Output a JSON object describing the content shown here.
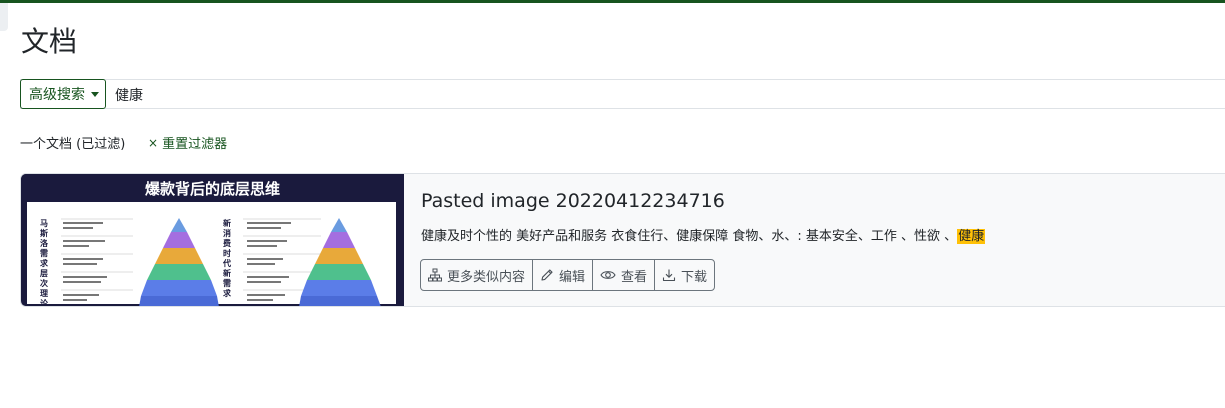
{
  "page": {
    "title": "文档"
  },
  "search": {
    "advanced_label": "高级搜索",
    "query": "健康"
  },
  "results": {
    "count_text": "一个文档 (已过滤)",
    "reset_label": "重置过滤器",
    "reset_icon": "close-icon"
  },
  "document": {
    "title": "Pasted image 20220412234716",
    "thumbnail": {
      "header": "爆款背后的底层思维",
      "left_caption": "马斯洛需求层次理论",
      "right_caption": "新消费时代新需求"
    },
    "snippet_prefix": "健康及时个性的 美好产品和服务 衣食住行、健康保障 食物、水、: 基本安全、工作 、性欲 、",
    "snippet_highlight": "健康",
    "actions": [
      {
        "label": "更多类似内容",
        "icon": "sitemap-icon"
      },
      {
        "label": "编辑",
        "icon": "pencil-icon"
      },
      {
        "label": "查看",
        "icon": "eye-icon"
      },
      {
        "label": "下载",
        "icon": "download-icon"
      }
    ]
  },
  "colors": {
    "brand": "#17541f",
    "highlight": "#ffc107",
    "thumb_bg": "#1a1a3d"
  }
}
